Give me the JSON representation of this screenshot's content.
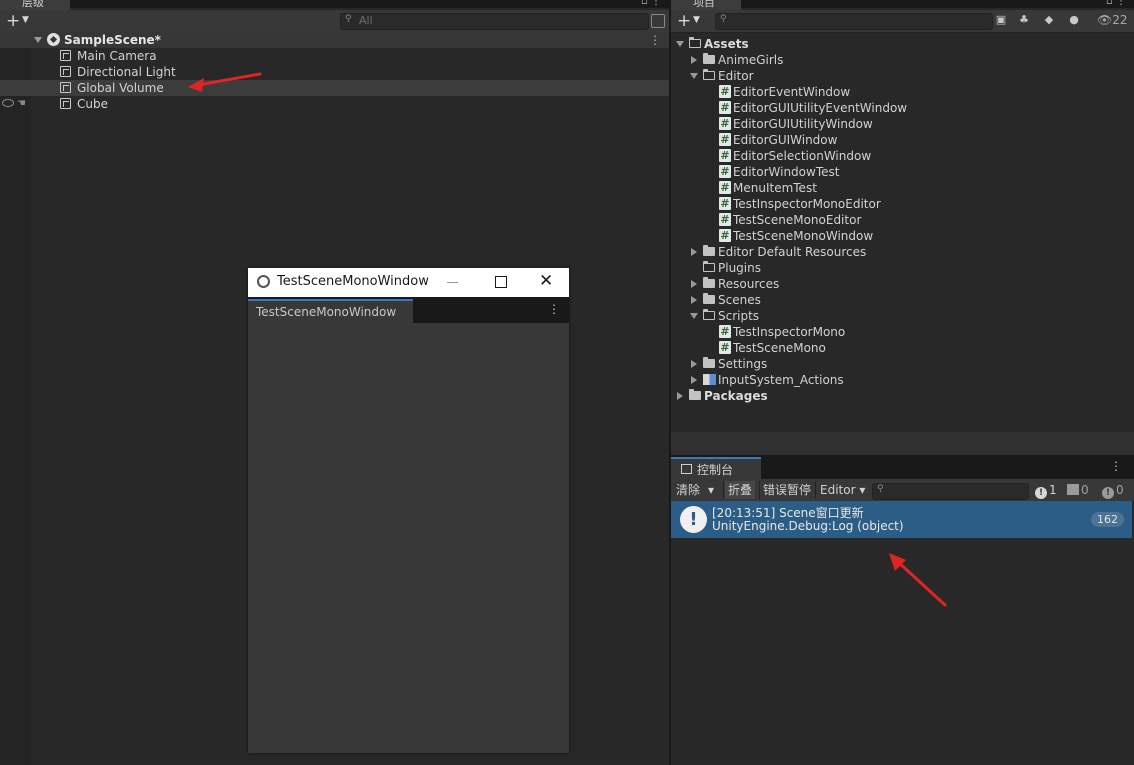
{
  "hierarchy": {
    "tab_label": "层级",
    "search_placeholder": "All",
    "scene_name": "SampleScene*",
    "objects": [
      "Main Camera",
      "Directional Light",
      "Global Volume",
      "Cube"
    ]
  },
  "floating_window": {
    "title": "TestSceneMonoWindow",
    "tab_label": "TestSceneMonoWindow"
  },
  "project": {
    "tab_label": "项目",
    "hidden_count": "22",
    "tree": [
      {
        "label": "Assets",
        "kind": "folder-open",
        "depth": 0,
        "expand": "down",
        "bold": true
      },
      {
        "label": "AnimeGirls",
        "kind": "folder",
        "depth": 1,
        "expand": "right"
      },
      {
        "label": "Editor",
        "kind": "folder-open",
        "depth": 1,
        "expand": "down"
      },
      {
        "label": "EditorEventWindow",
        "kind": "script",
        "depth": 2
      },
      {
        "label": "EditorGUIUtilityEventWindow",
        "kind": "script",
        "depth": 2
      },
      {
        "label": "EditorGUIUtilityWindow",
        "kind": "script",
        "depth": 2
      },
      {
        "label": "EditorGUIWindow",
        "kind": "script",
        "depth": 2
      },
      {
        "label": "EditorSelectionWindow",
        "kind": "script",
        "depth": 2
      },
      {
        "label": "EditorWindowTest",
        "kind": "script",
        "depth": 2
      },
      {
        "label": "MenuItemTest",
        "kind": "script",
        "depth": 2
      },
      {
        "label": "TestInspectorMonoEditor",
        "kind": "script",
        "depth": 2
      },
      {
        "label": "TestSceneMonoEditor",
        "kind": "script",
        "depth": 2
      },
      {
        "label": "TestSceneMonoWindow",
        "kind": "script",
        "depth": 2
      },
      {
        "label": "Editor Default Resources",
        "kind": "folder",
        "depth": 1,
        "expand": "right"
      },
      {
        "label": "Plugins",
        "kind": "folder-empty",
        "depth": 1
      },
      {
        "label": "Resources",
        "kind": "folder",
        "depth": 1,
        "expand": "right"
      },
      {
        "label": "Scenes",
        "kind": "folder",
        "depth": 1,
        "expand": "right"
      },
      {
        "label": "Scripts",
        "kind": "folder-open",
        "depth": 1,
        "expand": "down"
      },
      {
        "label": "TestInspectorMono",
        "kind": "script",
        "depth": 2
      },
      {
        "label": "TestSceneMono",
        "kind": "script",
        "depth": 2
      },
      {
        "label": "Settings",
        "kind": "folder",
        "depth": 1,
        "expand": "right"
      },
      {
        "label": "InputSystem_Actions",
        "kind": "asset",
        "depth": 1,
        "expand": "right"
      },
      {
        "label": "Packages",
        "kind": "folder",
        "depth": 0,
        "expand": "right",
        "bold": true
      }
    ]
  },
  "console": {
    "tab_label": "控制台",
    "clear_label": "清除",
    "collapse_label": "折叠",
    "error_pause_label": "错误暂停",
    "editor_label": "Editor",
    "log_count": "1",
    "warning_count": "0",
    "error_count": "0",
    "entry": {
      "line1": "[20:13:51] Scene窗口更新",
      "line2": "UnityEngine.Debug:Log (object)",
      "count": "162"
    }
  },
  "colors": {
    "accent_tab": "#3a79bb",
    "selected_log": "#2c5d87",
    "annotation_arrow": "#e02424"
  }
}
